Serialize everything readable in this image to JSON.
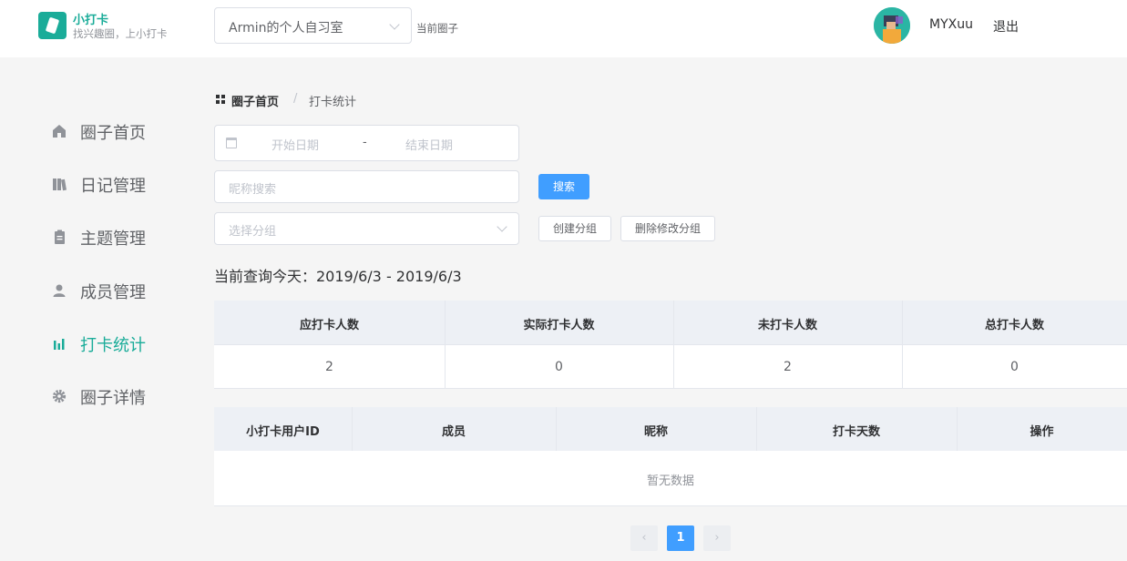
{
  "app": {
    "name": "小打卡",
    "slogan": "找兴趣圈，上小打卡"
  },
  "header": {
    "circle_select_value": "Armin的个人自习室",
    "current_circle_label": "当前圈子",
    "username": "MYXuu",
    "logout_label": "退出"
  },
  "sidebar": {
    "items": [
      {
        "label": "圈子首页",
        "icon": "home-icon",
        "active": false
      },
      {
        "label": "日记管理",
        "icon": "books-icon",
        "active": false
      },
      {
        "label": "主题管理",
        "icon": "clipboard-icon",
        "active": false
      },
      {
        "label": "成员管理",
        "icon": "user-icon",
        "active": false
      },
      {
        "label": "打卡统计",
        "icon": "bar-chart-icon",
        "active": true
      },
      {
        "label": "圈子详情",
        "icon": "gear-icon",
        "active": false
      }
    ]
  },
  "breadcrumb": {
    "home": "圈子首页",
    "separator": "/",
    "current": "打卡统计"
  },
  "filters": {
    "start_date_placeholder": "开始日期",
    "date_separator": "-",
    "end_date_placeholder": "结束日期",
    "nickname_placeholder": "昵称搜索",
    "search_button": "搜索",
    "group_placeholder": "选择分组",
    "create_group_button": "创建分组",
    "delete_group_button": "删除修改分组"
  },
  "query_text": "当前查询今天：2019/6/3 - 2019/6/3",
  "stats_table": {
    "headers": [
      "应打卡人数",
      "实际打卡人数",
      "未打卡人数",
      "总打卡人数"
    ],
    "values": [
      "2",
      "0",
      "2",
      "0"
    ]
  },
  "members_table": {
    "headers": [
      "小打卡用户ID",
      "成员",
      "昵称",
      "打卡天数",
      "操作"
    ],
    "empty_text": "暂无数据"
  },
  "pagination": {
    "prev": "‹",
    "current_page": "1",
    "next": "›"
  },
  "colors": {
    "accent": "#1aac99",
    "primary": "#409eff",
    "header_bg": "#edf0f5",
    "page_bg": "#f5f5f5"
  }
}
